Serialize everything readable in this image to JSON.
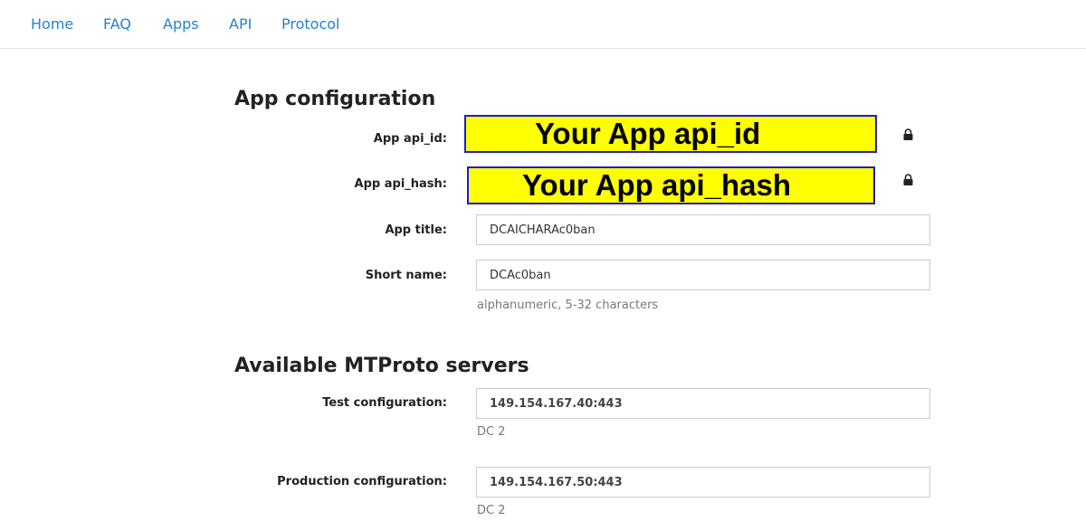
{
  "nav": {
    "items": [
      {
        "label": "Home"
      },
      {
        "label": "FAQ"
      },
      {
        "label": "Apps"
      },
      {
        "label": "API"
      },
      {
        "label": "Protocol"
      }
    ]
  },
  "app_config": {
    "title": "App configuration",
    "api_id": {
      "label": "App api_id:",
      "overlay_text": "Your App api_id",
      "icon": "lock-icon"
    },
    "api_hash": {
      "label": "App api_hash:",
      "overlay_text": "Your App api_hash",
      "icon": "lock-icon"
    },
    "app_title": {
      "label": "App title:",
      "value": "DCAICHARAc0ban"
    },
    "short_name": {
      "label": "Short name:",
      "value": "DCAc0ban",
      "help": "alphanumeric, 5-32 characters"
    }
  },
  "servers": {
    "title": "Available MTProto servers",
    "test": {
      "label": "Test configuration:",
      "value": "149.154.167.40:443",
      "dc": "DC 2"
    },
    "production": {
      "label": "Production configuration:",
      "value": "149.154.167.50:443",
      "dc": "DC 2"
    }
  },
  "colors": {
    "link": "#2481cc",
    "highlight": "#ffff00",
    "highlight_border": "#1c1cd6"
  }
}
